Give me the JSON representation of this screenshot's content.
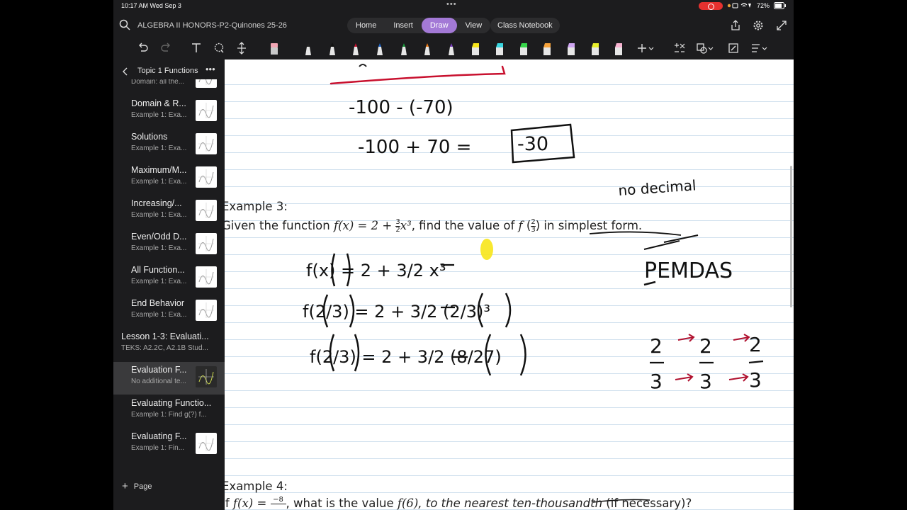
{
  "status": {
    "time": "10:17 AM  Wed Sep 3",
    "battery": "72%"
  },
  "notebook": {
    "title": "ALGEBRA II HONORS-P2-Quinones 25-26"
  },
  "tabs": [
    {
      "label": "Home",
      "active": false
    },
    {
      "label": "Insert",
      "active": false
    },
    {
      "label": "Draw",
      "active": true
    },
    {
      "label": "View",
      "active": false
    }
  ],
  "class_notebook": "Class Notebook",
  "sidebar": {
    "section_title": "Topic 1 Functions",
    "add_page": "Page",
    "pages": [
      {
        "title": "Vocabulary",
        "subtitle": "Domain: all the...",
        "indent": true,
        "thumb": true,
        "selected": false
      },
      {
        "title": "Domain & R...",
        "subtitle": "Example 1:  Exa...",
        "indent": true,
        "thumb": true,
        "selected": false
      },
      {
        "title": "Solutions",
        "subtitle": "Example 1:  Exa...",
        "indent": true,
        "thumb": true,
        "selected": false
      },
      {
        "title": "Maximum/M...",
        "subtitle": "Example 1:  Exa...",
        "indent": true,
        "thumb": true,
        "selected": false
      },
      {
        "title": "Increasing/...",
        "subtitle": "Example 1:  Exa...",
        "indent": true,
        "thumb": true,
        "selected": false
      },
      {
        "title": "Even/Odd D...",
        "subtitle": "Example 1:  Exa...",
        "indent": true,
        "thumb": true,
        "selected": false
      },
      {
        "title": "All Function...",
        "subtitle": "Example 1:  Exa...",
        "indent": true,
        "thumb": true,
        "selected": false
      },
      {
        "title": "End Behavior",
        "subtitle": "Example 1:  Exa...",
        "indent": true,
        "thumb": true,
        "selected": false
      },
      {
        "title": "Lesson 1-3: Evaluati...",
        "subtitle": "TEKS: A2.2C, A2.1B  Stud...",
        "indent": false,
        "thumb": false,
        "selected": false
      },
      {
        "title": "Evaluation F...",
        "subtitle": "No additional te...",
        "indent": true,
        "thumb": true,
        "selected": true
      },
      {
        "title": "Evaluating Functio...",
        "subtitle": "Example 1:  Find g(?) f...",
        "indent": true,
        "thumb": false,
        "selected": false
      },
      {
        "title": "Evaluating F...",
        "subtitle": "Example 1:  Fin...",
        "indent": true,
        "thumb": true,
        "selected": false
      }
    ]
  },
  "canvas": {
    "example3_heading": "Example 3:",
    "example3_prefix": "Given the function ",
    "example3_fx": "f(x) = 2 + ",
    "example3_frac_num": "3",
    "example3_frac_den": "2",
    "example3_xcube": "x³",
    "example3_mid": ", find the value of ",
    "example3_f": "f",
    "example3_arg_num": "2",
    "example3_arg_den": "3",
    "example3_tail": " in simplest form.",
    "example4_heading": "Example 4:",
    "example4_prefix": "If ",
    "example4_fx": "f(x) = ",
    "example4_num": "−8",
    "example4_mid": ", what is the value ",
    "example4_f6": "f(6)",
    "example4_italic": ", to the nearest ten-thousandth",
    "example4_tail": " (if necessary)?",
    "handwritten": {
      "line1": "-100  - (-70)",
      "line2": "-100 + 70 =",
      "answer": "-30",
      "note": "no decimal",
      "pemdas": "PEMDAS",
      "step1": "f(x) = 2 + 3/2 x³",
      "step2": "f(2/3) = 2 + 3/2 (2/3)³",
      "step3": "f(2/3) = 2 + 3/2 (8/27)"
    }
  }
}
